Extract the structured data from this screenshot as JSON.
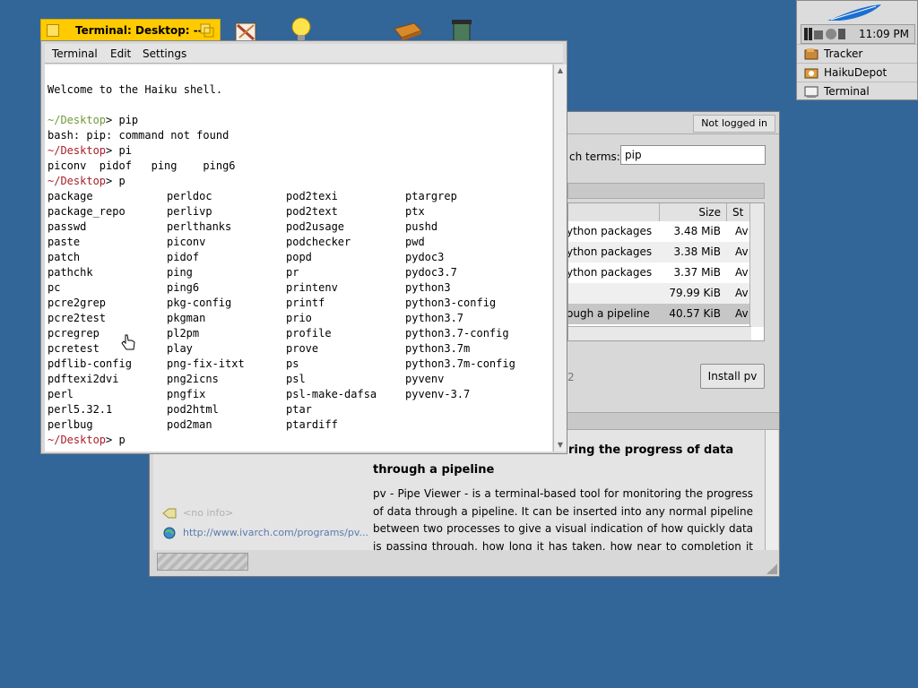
{
  "deskbar": {
    "clock": "11:09 PM",
    "items": [
      {
        "label": "Tracker",
        "icon": "tracker-icon"
      },
      {
        "label": "HaikuDepot",
        "icon": "haikudepot-icon"
      },
      {
        "label": "Terminal",
        "icon": "terminal-icon"
      }
    ]
  },
  "terminal": {
    "title": "Terminal: Desktop: --",
    "menu": [
      "Terminal",
      "Edit",
      "Settings"
    ],
    "welcome": "Welcome to the Haiku shell.",
    "prompt": "~/Desktop",
    "history": [
      {
        "cmd": "pip"
      },
      {
        "output": "bash: pip: command not found"
      },
      {
        "cmd": "pi"
      },
      {
        "output": "piconv  pidof   ping    ping6"
      },
      {
        "cmd": "p"
      }
    ],
    "completions": [
      [
        "package",
        "perldoc",
        "pod2texi",
        "ptargrep"
      ],
      [
        "package_repo",
        "perlivp",
        "pod2text",
        "ptx"
      ],
      [
        "passwd",
        "perlthanks",
        "pod2usage",
        "pushd"
      ],
      [
        "paste",
        "piconv",
        "podchecker",
        "pwd"
      ],
      [
        "patch",
        "pidof",
        "popd",
        "pydoc3"
      ],
      [
        "pathchk",
        "ping",
        "pr",
        "pydoc3.7"
      ],
      [
        "pc",
        "ping6",
        "printenv",
        "python3"
      ],
      [
        "pcre2grep",
        "pkg-config",
        "printf",
        "python3-config"
      ],
      [
        "pcre2test",
        "pkgman",
        "prio",
        "python3.7"
      ],
      [
        "pcregrep",
        "pl2pm",
        "profile",
        "python3.7-config"
      ],
      [
        "pcretest",
        "play",
        "prove",
        "python3.7m"
      ],
      [
        "pdflib-config",
        "png-fix-itxt",
        "ps",
        "python3.7m-config"
      ],
      [
        "pdftexi2dvi",
        "png2icns",
        "psl",
        "pyvenv"
      ],
      [
        "perl",
        "pngfix",
        "psl-make-dafsa",
        "pyvenv-3.7"
      ],
      [
        "perl5.32.1",
        "pod2html",
        "ptar",
        ""
      ],
      [
        "perlbug",
        "pod2man",
        "ptardiff",
        ""
      ]
    ],
    "final_cmd": "p"
  },
  "depot": {
    "login_status": "Not logged in",
    "search_label": "ch terms:",
    "search_value": "pip",
    "columns": {
      "size": "Size",
      "status": "St"
    },
    "packages": [
      {
        "summary": "ython packages",
        "size": "3.48 MiB",
        "status": "Av"
      },
      {
        "summary": "ython packages",
        "size": "3.38 MiB",
        "status": "Av"
      },
      {
        "summary": "ython packages",
        "size": "3.37 MiB",
        "status": "Av"
      },
      {
        "summary": "",
        "size": "79.99 KiB",
        "status": "Av"
      },
      {
        "summary": "ough a pipeline",
        "size": "40.57 KiB",
        "status": "Av"
      }
    ],
    "count_text": "2",
    "install_button": "Install pv",
    "desc_title_line1": "ring the progress of data",
    "desc_title_line2": "through a pipeline",
    "description": "pv - Pipe Viewer - is a terminal-based tool for monitoring the progress of data through a pipeline. It can be inserted into any normal pipeline between two processes to give a visual indication of how quickly data is passing through, how long it has taken, how near to completion it is, and an estimate of how long it",
    "rating_text": "<no info>",
    "homepage": "http://www.ivarch.com/programs/pv..."
  },
  "colors": {
    "desktop": "#336698",
    "terminal_tab": "#ffcb00",
    "prompt_green": "#6f9a3a",
    "prompt_red": "#a8202a"
  }
}
